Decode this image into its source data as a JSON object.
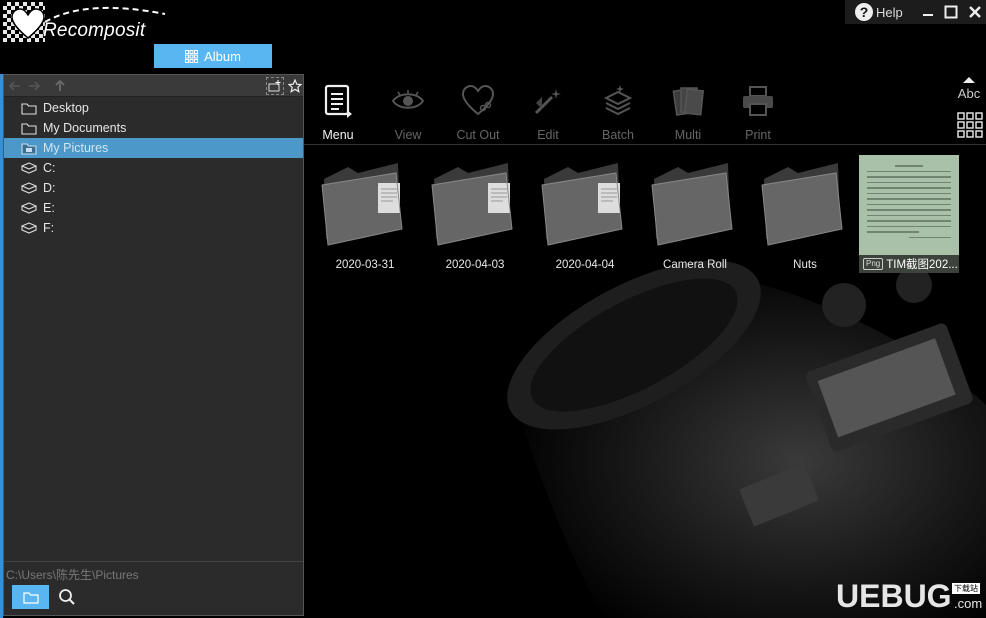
{
  "app": {
    "logo_text": "Recomposit"
  },
  "header": {
    "album_tab": "Album"
  },
  "window_controls": {
    "help": "Help"
  },
  "sidebar": {
    "items": [
      {
        "label": "Desktop",
        "icon": "folder-icon"
      },
      {
        "label": "My Documents",
        "icon": "folder-icon"
      },
      {
        "label": "My Pictures",
        "icon": "pictures-folder-icon",
        "selected": true
      },
      {
        "label": "C:",
        "icon": "drive-icon"
      },
      {
        "label": "D:",
        "icon": "drive-icon"
      },
      {
        "label": "E:",
        "icon": "drive-icon"
      },
      {
        "label": "F:",
        "icon": "drive-icon"
      }
    ],
    "path": "C:\\Users\\陈先生\\Pictures"
  },
  "toolbar": {
    "tools": [
      {
        "label": "Menu",
        "state": "active"
      },
      {
        "label": "View",
        "state": "disabled"
      },
      {
        "label": "Cut Out",
        "state": "disabled"
      },
      {
        "label": "Edit",
        "state": "disabled"
      },
      {
        "label": "Batch",
        "state": "disabled"
      },
      {
        "label": "Multi",
        "state": "disabled"
      },
      {
        "label": "Print",
        "state": "disabled"
      }
    ],
    "sort_label": "Abc"
  },
  "content": {
    "items": [
      {
        "label": "2020-03-31",
        "type": "folder-with-doc"
      },
      {
        "label": "2020-04-03",
        "type": "folder-with-doc"
      },
      {
        "label": "2020-04-04",
        "type": "folder-with-doc"
      },
      {
        "label": "Camera Roll",
        "type": "folder"
      },
      {
        "label": "Nuts",
        "type": "folder"
      },
      {
        "label": "TIM截图202...",
        "type": "image",
        "badge": "Png"
      }
    ]
  },
  "watermark": {
    "text": "UEBUG",
    "suffix": ".com",
    "tag": "下载站"
  },
  "colors": {
    "accent": "#5ab6f0",
    "selected": "#4c98c8",
    "panel": "#2b2b2b"
  }
}
